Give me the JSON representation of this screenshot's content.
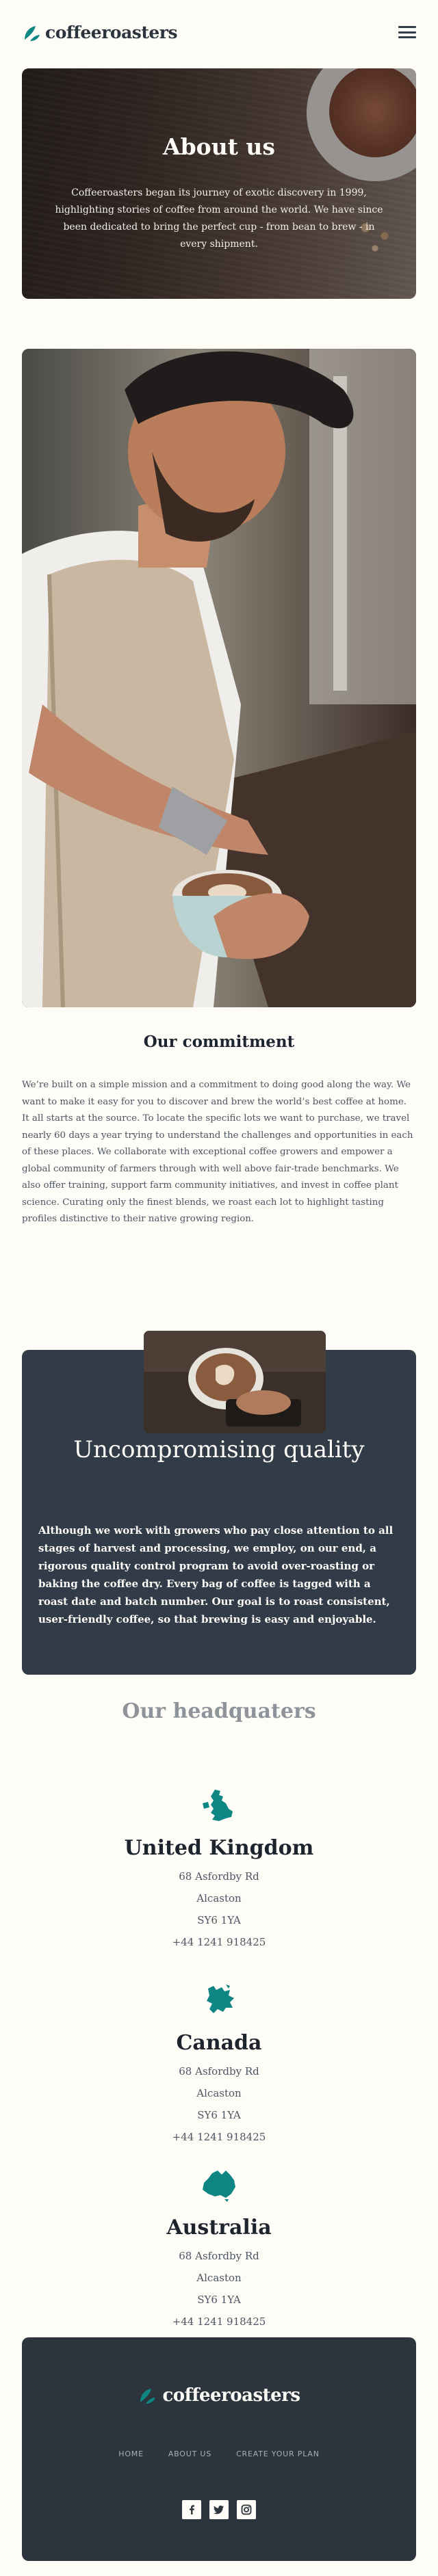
{
  "brand": {
    "name": "coffeeroasters",
    "accent": "#0e8784"
  },
  "header": {
    "menu_icon": "hamburger-icon"
  },
  "hero": {
    "title": "About us",
    "text": "Coffeeroasters began its journey of exotic discovery in 1999, highlighting stories of coffee from around the world. We have since been dedicated to bring the perfect cup - from bean to brew - in every shipment."
  },
  "commitment": {
    "title": "Our commitment",
    "text": "We’re built on a simple mission and a commitment to doing good along the way. We want to make it easy for you to discover and brew the world’s best coffee at home. It all starts at the source. To locate the specific lots we want to purchase, we travel nearly 60 days a year trying to understand the challenges and opportunities in each of these places. We collaborate with exceptional coffee growers and empower a global community of farmers through with well above fair-trade benchmarks. We also offer training, support farm community initiatives, and invest in coffee plant science. Curating only the finest blends, we roast each lot to highlight tasting profiles distinctive to their native growing region."
  },
  "quality": {
    "title": "Uncompromising quality",
    "text": "Although we work with growers who pay close attention to all stages of harvest and processing, we employ, on our end, a rigorous quality control program to avoid over-roasting or baking the coffee dry. Every bag of coffee is tagged with a roast date and batch number. Our goal is to roast consistent, user-friendly coffee, so that brewing is easy and enjoyable."
  },
  "headquarters": {
    "title": "Our headquaters",
    "locations": [
      {
        "country": "United Kingdom",
        "icon": "uk-map-icon",
        "address1": "68 Asfordby Rd",
        "city": "Alcaston",
        "postcode": "SY6 1YA",
        "phone": "+44 1241 918425"
      },
      {
        "country": "Canada",
        "icon": "canada-map-icon",
        "address1": "68 Asfordby Rd",
        "city": "Alcaston",
        "postcode": "SY6 1YA",
        "phone": "+44 1241 918425"
      },
      {
        "country": "Australia",
        "icon": "australia-map-icon",
        "address1": "68 Asfordby Rd",
        "city": "Alcaston",
        "postcode": "SY6 1YA",
        "phone": "+44 1241 918425"
      }
    ]
  },
  "footer": {
    "nav": [
      "HOME",
      "ABOUT US",
      "CREATE YOUR PLAN"
    ],
    "social": [
      "facebook-icon",
      "twitter-icon",
      "instagram-icon"
    ]
  }
}
